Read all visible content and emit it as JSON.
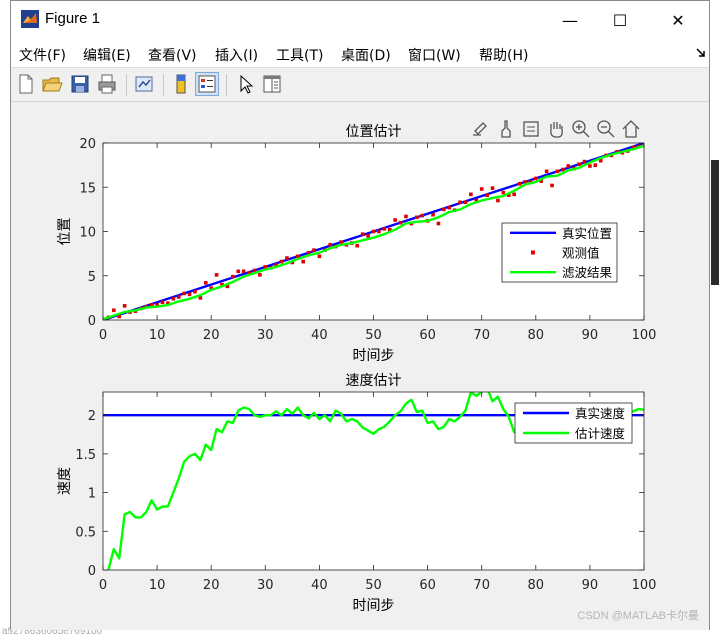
{
  "window": {
    "title": "Figure 1",
    "controls": {
      "minimize": "—",
      "maximize": "☐",
      "close": "✕"
    }
  },
  "menu": {
    "items": [
      "文件(F)",
      "编辑(E)",
      "查看(V)",
      "插入(I)",
      "工具(T)",
      "桌面(D)",
      "窗口(W)",
      "帮助(H)"
    ]
  },
  "toolbar": {
    "buttons": [
      "new-figure",
      "open-file",
      "save",
      "print",
      "link-plot",
      "insert-colorbar",
      "insert-legend",
      "edit-plot-arrow",
      "property-inspector"
    ]
  },
  "axes_toolbar": [
    "export-icon",
    "brush-icon",
    "data-tips-icon",
    "pan-hand-icon",
    "zoom-in-icon",
    "zoom-out-icon",
    "home-icon"
  ],
  "chart_data": [
    {
      "type": "line",
      "title": "位置估计",
      "xlabel": "时间步",
      "ylabel": "位置",
      "xlim": [
        0,
        100
      ],
      "ylim": [
        0,
        20
      ],
      "xticks": [
        "0",
        "10",
        "20",
        "30",
        "40",
        "50",
        "60",
        "70",
        "80",
        "90",
        "100"
      ],
      "yticks": [
        "0",
        "5",
        "10",
        "15",
        "20"
      ],
      "grid": false,
      "legend_position": "right",
      "series": [
        {
          "name": "真实位置",
          "style": "line",
          "color": "#0000ff",
          "x": [
            0,
            100
          ],
          "y": [
            0,
            20
          ]
        },
        {
          "name": "观测值",
          "style": "markers",
          "color": "#e00000",
          "x": [
            1,
            2,
            3,
            4,
            5,
            6,
            7,
            8,
            9,
            10,
            11,
            12,
            13,
            14,
            15,
            16,
            17,
            18,
            19,
            20,
            21,
            22,
            23,
            24,
            25,
            26,
            27,
            28,
            29,
            30,
            31,
            32,
            33,
            34,
            35,
            36,
            37,
            38,
            39,
            40,
            41,
            42,
            43,
            44,
            45,
            46,
            47,
            48,
            49,
            50,
            51,
            52,
            53,
            54,
            55,
            56,
            57,
            58,
            59,
            60,
            61,
            62,
            63,
            64,
            65,
            66,
            67,
            68,
            69,
            70,
            71,
            72,
            73,
            74,
            75,
            76,
            77,
            78,
            79,
            80,
            81,
            82,
            83,
            84,
            85,
            86,
            87,
            88,
            89,
            90,
            91,
            92,
            93,
            94,
            95,
            96,
            97,
            98,
            99,
            100
          ],
          "y": [
            0.3,
            1.1,
            0.4,
            1.6,
            0.9,
            1.0,
            1.3,
            1.5,
            1.7,
            1.7,
            2.0,
            1.9,
            2.4,
            2.6,
            3.0,
            2.9,
            3.2,
            2.5,
            4.2,
            3.6,
            5.1,
            4.0,
            3.8,
            4.9,
            5.5,
            5.5,
            5.3,
            5.6,
            5.1,
            6.0,
            5.9,
            6.2,
            6.6,
            7.0,
            6.5,
            7.2,
            6.6,
            7.6,
            7.9,
            7.2,
            7.9,
            8.5,
            8.3,
            8.8,
            8.5,
            8.7,
            8.4,
            9.7,
            9.5,
            10.0,
            10.0,
            10.3,
            10.2,
            11.3,
            11.0,
            11.7,
            10.9,
            11.6,
            11.8,
            11.2,
            11.9,
            10.9,
            12.5,
            12.7,
            12.4,
            13.3,
            13.3,
            14.2,
            13.5,
            14.8,
            14.1,
            14.9,
            13.5,
            14.4,
            14.1,
            14.2,
            15.4,
            15.6,
            15.6,
            16.0,
            15.7,
            16.8,
            15.2,
            16.8,
            17.0,
            17.4,
            17.1,
            17.6,
            17.9,
            17.4,
            17.5,
            18.0,
            18.6,
            18.6,
            19.0,
            18.9,
            19.1,
            19.5,
            19.6,
            19.7
          ]
        },
        {
          "name": "滤波结果",
          "style": "line",
          "color": "#00ff00",
          "x": [
            0,
            2,
            4,
            6,
            8,
            10,
            12,
            14,
            16,
            18,
            20,
            22,
            24,
            26,
            28,
            30,
            32,
            34,
            36,
            38,
            40,
            42,
            44,
            46,
            48,
            50,
            52,
            54,
            56,
            58,
            60,
            62,
            64,
            66,
            68,
            70,
            72,
            74,
            76,
            78,
            80,
            82,
            84,
            86,
            88,
            90,
            92,
            94,
            96,
            98,
            100
          ],
          "y": [
            0.1,
            0.5,
            0.9,
            1.1,
            1.4,
            1.5,
            1.7,
            2.1,
            2.4,
            2.8,
            3.4,
            3.8,
            4.3,
            4.9,
            5.3,
            5.7,
            6.0,
            6.4,
            6.9,
            7.3,
            7.6,
            8.1,
            8.5,
            8.7,
            9.0,
            9.3,
            9.7,
            10.2,
            10.9,
            11.1,
            11.2,
            11.6,
            12.2,
            12.5,
            13.1,
            13.5,
            13.8,
            14.0,
            14.6,
            15.3,
            15.6,
            16.2,
            16.3,
            16.9,
            17.2,
            17.8,
            18.3,
            18.7,
            19.0,
            19.3,
            19.7
          ]
        }
      ]
    },
    {
      "type": "line",
      "title": "速度估计",
      "xlabel": "时间步",
      "ylabel": "速度",
      "xlim": [
        0,
        100
      ],
      "ylim": [
        0,
        2.3
      ],
      "xticks": [
        "0",
        "10",
        "20",
        "30",
        "40",
        "50",
        "60",
        "70",
        "80",
        "90",
        "100"
      ],
      "yticks": [
        "0",
        "0.5",
        "1",
        "1.5",
        "2"
      ],
      "grid": false,
      "legend_position": "top-right",
      "series": [
        {
          "name": "真实速度",
          "style": "line",
          "color": "#0000ff",
          "x": [
            0,
            100
          ],
          "y": [
            2,
            2
          ]
        },
        {
          "name": "估计速度",
          "style": "line",
          "color": "#00ff00",
          "x": [
            1,
            2,
            3,
            4,
            5,
            6,
            7,
            8,
            9,
            10,
            11,
            12,
            13,
            14,
            15,
            16,
            17,
            18,
            19,
            20,
            21,
            22,
            23,
            24,
            25,
            26,
            27,
            28,
            29,
            30,
            31,
            32,
            33,
            34,
            35,
            36,
            37,
            38,
            39,
            40,
            41,
            42,
            43,
            44,
            45,
            46,
            47,
            48,
            49,
            50,
            51,
            52,
            53,
            54,
            55,
            56,
            57,
            58,
            59,
            60,
            61,
            62,
            63,
            64,
            65,
            66,
            67,
            68,
            69,
            70,
            71,
            72,
            73,
            74,
            75,
            76,
            77,
            78,
            79,
            80,
            81,
            82,
            83,
            84,
            85,
            86,
            87,
            88,
            89,
            90,
            91,
            92,
            93,
            94,
            95,
            96,
            97,
            98,
            99,
            100
          ],
          "y": [
            0.0,
            0.27,
            0.15,
            0.72,
            0.75,
            0.68,
            0.68,
            0.75,
            0.9,
            0.78,
            0.82,
            0.82,
            1.0,
            1.18,
            1.4,
            1.47,
            1.5,
            1.42,
            1.62,
            1.55,
            1.82,
            1.78,
            1.92,
            1.9,
            2.06,
            2.1,
            2.08,
            2.0,
            1.98,
            2.0,
            2.0,
            2.05,
            2.0,
            2.08,
            2.02,
            2.1,
            2.0,
            1.96,
            2.03,
            1.95,
            2.0,
            1.92,
            2.06,
            2.02,
            1.92,
            1.95,
            1.92,
            1.84,
            1.8,
            1.76,
            1.82,
            1.85,
            1.92,
            2.0,
            2.05,
            2.15,
            2.2,
            2.04,
            2.06,
            1.9,
            1.92,
            1.82,
            1.85,
            1.95,
            1.92,
            1.98,
            2.06,
            2.3,
            2.25,
            2.3,
            2.35,
            2.18,
            2.24,
            2.08,
            1.98,
            1.78,
            1.8,
            1.84,
            1.85,
            1.9,
            1.95,
            1.94,
            1.9,
            1.92,
            1.9,
            1.92,
            1.9,
            1.92,
            1.92,
            1.95,
            1.98,
            1.98,
            2.0,
            2.02,
            2.04,
            2.03,
            2.04,
            2.05,
            2.08,
            2.07
          ]
        }
      ]
    }
  ],
  "watermark": "CSDN @MATLAB卡尔曼",
  "background_text": "a9278636065e769100"
}
